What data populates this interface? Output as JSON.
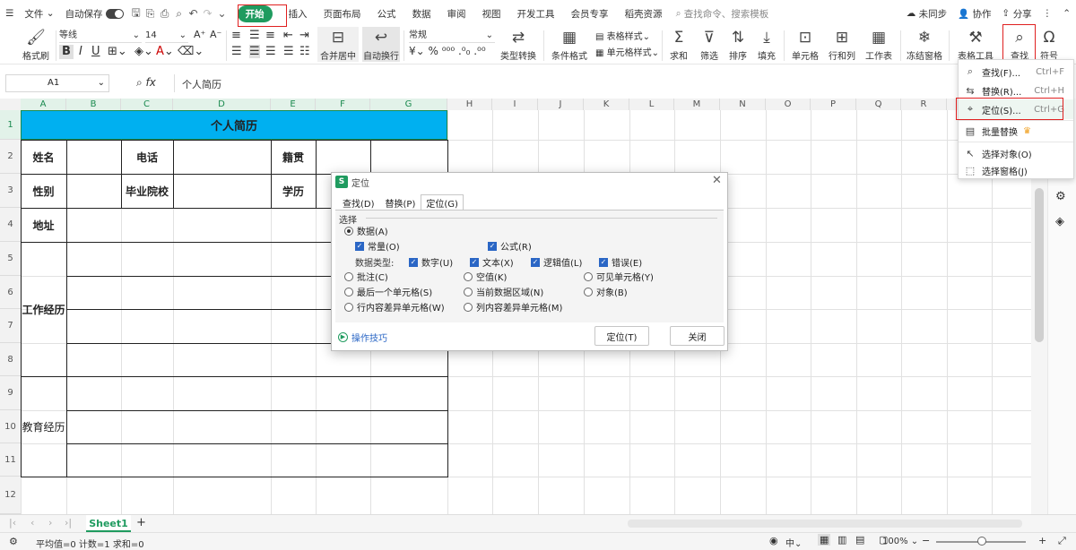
{
  "menubar": {
    "file": "文件",
    "autosave": "自动保存",
    "tabs": [
      "开始",
      "插入",
      "页面布局",
      "公式",
      "数据",
      "审阅",
      "视图",
      "开发工具",
      "会员专享",
      "稻壳资源"
    ],
    "search_placeholder": "查找命令、搜索模板",
    "sync": "未同步",
    "collab": "协作",
    "share": "分享"
  },
  "ribbon": {
    "format_painter": "格式刷",
    "font_name": "等线",
    "font_size": "14",
    "merge_center": "合并居中",
    "wrap_text": "自动换行",
    "number_format": "常规",
    "type_convert": "类型转换",
    "table_style": "表格样式",
    "cond_format": "条件格式",
    "cell_style": "单元格样式",
    "sum": "求和",
    "filter": "筛选",
    "sort": "排序",
    "fill": "填充",
    "cells": "单元格",
    "rowcol": "行和列",
    "worksheet": "工作表",
    "freeze": "冻结窗格",
    "table_tools": "表格工具",
    "find": "查找",
    "symbol": "符号"
  },
  "formula_bar": {
    "cell_ref": "A1",
    "content": "个人简历"
  },
  "columns": [
    "A",
    "B",
    "C",
    "D",
    "E",
    "F",
    "G",
    "H",
    "I",
    "J",
    "K",
    "L",
    "M",
    "N",
    "O",
    "P",
    "Q",
    "R",
    "S"
  ],
  "rows": [
    "1",
    "2",
    "3",
    "4",
    "5",
    "6",
    "7",
    "8",
    "9",
    "10",
    "11",
    "12"
  ],
  "resume": {
    "title": "个人简历",
    "name": "姓名",
    "phone": "电话",
    "origin": "籍贯",
    "gender": "性别",
    "school": "毕业院校",
    "education": "学历",
    "address": "地址",
    "work": "工作经历",
    "edu_history": "教育经历"
  },
  "find_menu": {
    "items": [
      {
        "label": "查找(F)...",
        "shortcut": "Ctrl+F"
      },
      {
        "label": "替换(R)...",
        "shortcut": "Ctrl+H"
      },
      {
        "label": "定位(S)...",
        "shortcut": "Ctrl+G"
      },
      {
        "label": "批量替换",
        "shortcut": ""
      },
      {
        "label": "选择对象(O)",
        "shortcut": ""
      },
      {
        "label": "选择窗格(J)",
        "shortcut": ""
      }
    ]
  },
  "dialog": {
    "title": "定位",
    "tabs": [
      "查找(D)",
      "替换(P)",
      "定位(G)"
    ],
    "section": "选择",
    "data": "数据(A)",
    "constant": "常量(O)",
    "formula": "公式(R)",
    "data_type": "数据类型:",
    "number": "数字(U)",
    "text": "文本(X)",
    "logical": "逻辑值(L)",
    "error": "错误(E)",
    "comment": "批注(C)",
    "blank": "空值(K)",
    "visible": "可见单元格(Y)",
    "last_cell": "最后一个单元格(S)",
    "current_region": "当前数据区域(N)",
    "object": "对象(B)",
    "row_diff": "行内容差异单元格(W)",
    "col_diff": "列内容差异单元格(M)",
    "tips": "操作技巧",
    "ok": "定位(T)",
    "close": "关闭"
  },
  "sheet_tab": "Sheet1",
  "status": {
    "text": "平均值=0  计数=1  求和=0",
    "zoom": "100%"
  },
  "colors": {
    "accent": "#1f9b5f",
    "title_fill": "#00b0f0",
    "highlight": "#e02020"
  }
}
